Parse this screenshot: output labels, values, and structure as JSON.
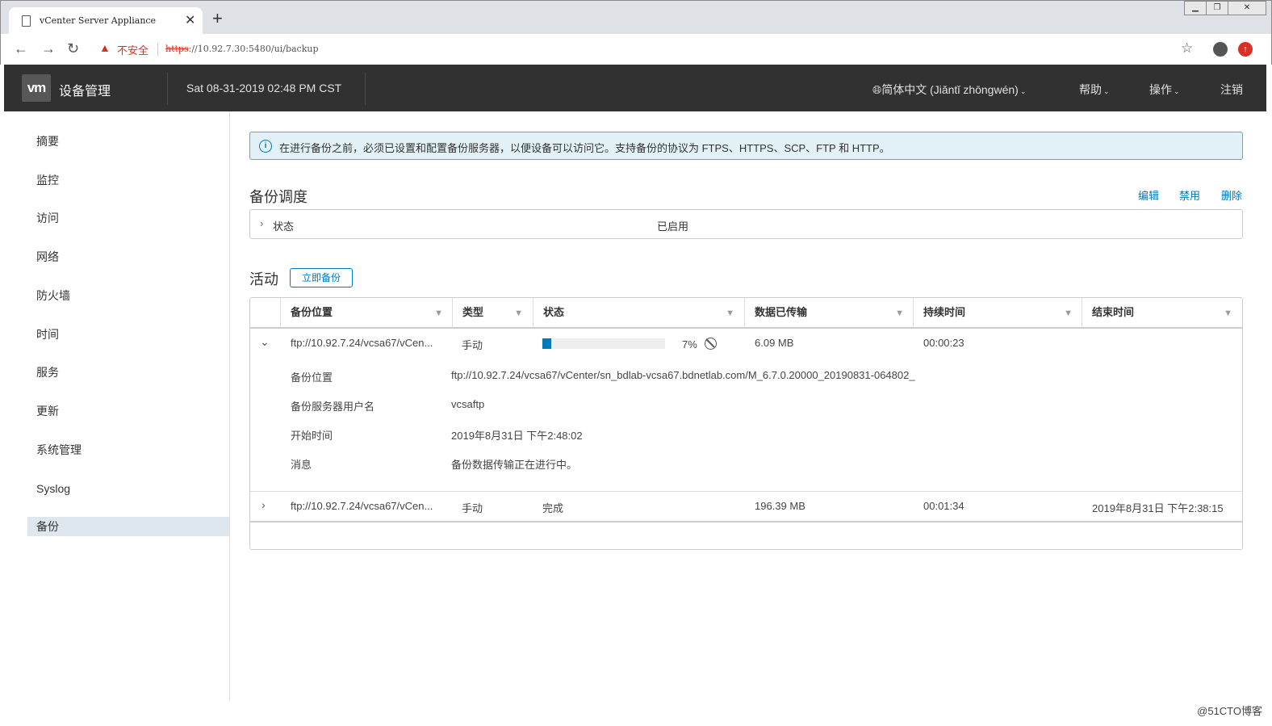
{
  "browser": {
    "tab_title": "vCenter Server Appliance",
    "tab_close": "✕",
    "new_tab": "+",
    "security_warning": "不安全",
    "url_scheme": "https",
    "url_rest": "://10.92.7.30:5480/ui/backup"
  },
  "header": {
    "logo": "vm",
    "title": "设备管理",
    "datetime": "Sat 08-31-2019 02:48 PM CST",
    "language": "简体中文 (Jiǎntǐ zhōngwén)",
    "help": "帮助",
    "actions": "操作",
    "logout": "注销"
  },
  "sidebar": {
    "items": [
      "摘要",
      "监控",
      "访问",
      "网络",
      "防火墙",
      "时间",
      "服务",
      "更新",
      "系统管理",
      "Syslog",
      "备份"
    ],
    "active": "备份"
  },
  "alert": {
    "text": "在进行备份之前，必须已设置和配置备份服务器，以便设备可以访问它。支持备份的协议为 FTPS、HTTPS、SCP、FTP 和 HTTP。"
  },
  "schedule": {
    "title": "备份调度",
    "edit": "编辑",
    "disable": "禁用",
    "delete": "删除",
    "status_label": "状态",
    "status_value": "已启用"
  },
  "activity": {
    "title": "活动",
    "backup_now": "立即备份",
    "columns": [
      "备份位置",
      "类型",
      "状态",
      "数据已传输",
      "持续时间",
      "结束时间"
    ],
    "rows": [
      {
        "location": "ftp://10.92.7.24/vcsa67/vCen...",
        "type": "手动",
        "status": "",
        "progress": 7,
        "progress_text": "7%",
        "transferred": "6.09 MB",
        "duration": "00:00:23",
        "end_time": ""
      },
      {
        "location": "ftp://10.92.7.24/vcsa67/vCen...",
        "type": "手动",
        "status": "完成",
        "transferred": "196.39 MB",
        "duration": "00:01:34",
        "end_time": "2019年8月31日 下午2:38:15"
      }
    ],
    "details": {
      "location_label": "备份位置",
      "location_value": "ftp://10.92.7.24/vcsa67/vCenter/sn_bdlab-vcsa67.bdnetlab.com/M_6.7.0.20000_20190831-064802_",
      "user_label": "备份服务器用户名",
      "user_value": "vcsaftp",
      "start_label": "开始时间",
      "start_value": "2019年8月31日 下午2:48:02",
      "message_label": "消息",
      "message_value": "备份数据传输正在进行中。"
    }
  },
  "watermark": "@51CTO博客",
  "colors": {
    "accent": "#0079b8",
    "header_bg": "#313131",
    "active_nav": "#dee6ee"
  }
}
